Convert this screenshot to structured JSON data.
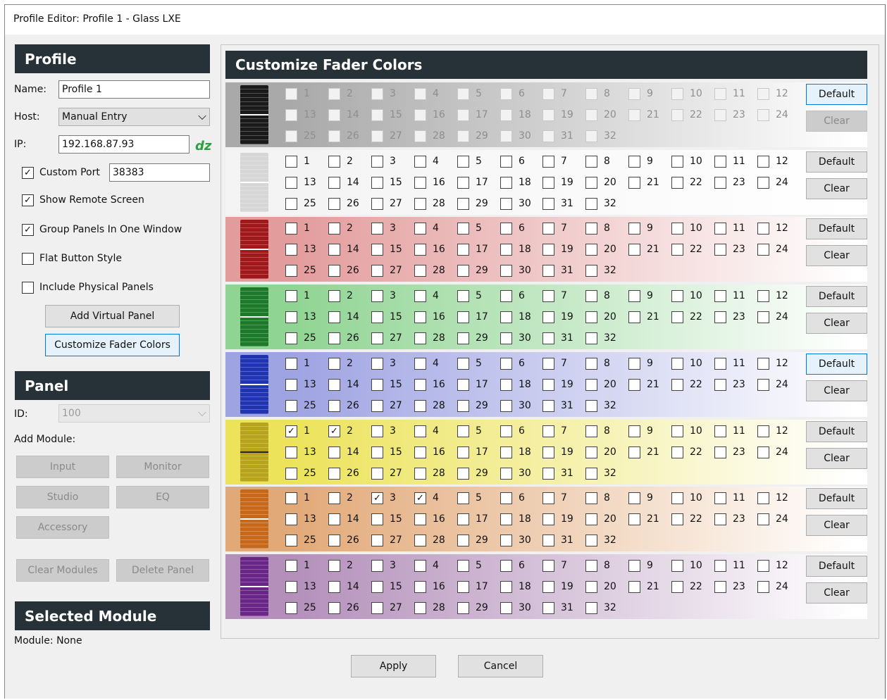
{
  "window": {
    "title": "Profile Editor: Profile 1 - Glass LXE"
  },
  "profile": {
    "header": "Profile",
    "name_label": "Name:",
    "name_value": "Profile 1",
    "host_label": "Host:",
    "host_value": "Manual Entry",
    "ip_label": "IP:",
    "ip_value": "192.168.87.93",
    "custom_port_label": "Custom Port",
    "custom_port_checked": true,
    "custom_port_value": "38383",
    "show_remote_label": "Show Remote Screen",
    "show_remote_checked": true,
    "group_panels_label": "Group Panels In One Window",
    "group_panels_checked": true,
    "flat_button_label": "Flat Button Style",
    "flat_button_checked": false,
    "include_physical_label": "Include Physical Panels",
    "include_physical_checked": false,
    "add_virtual_panel": "Add Virtual Panel",
    "customize_fader_colors": "Customize Fader Colors"
  },
  "panel": {
    "header": "Panel",
    "id_label": "ID:",
    "id_value": "100",
    "add_module_label": "Add Module:",
    "buttons": {
      "input": "Input",
      "monitor": "Monitor",
      "studio": "Studio",
      "eq": "EQ",
      "accessory": "Accessory",
      "clear_modules": "Clear Modules",
      "delete_panel": "Delete Panel"
    }
  },
  "selected_module": {
    "header": "Selected Module",
    "module_text": "Module: None"
  },
  "fader_colors": {
    "header": "Customize Fader Colors",
    "default_label": "Default",
    "clear_label": "Clear",
    "channels": [
      "1",
      "2",
      "3",
      "4",
      "5",
      "6",
      "7",
      "8",
      "9",
      "10",
      "11",
      "12",
      "13",
      "14",
      "15",
      "16",
      "17",
      "18",
      "19",
      "20",
      "21",
      "22",
      "23",
      "24",
      "25",
      "26",
      "27",
      "28",
      "29",
      "30",
      "31",
      "32"
    ],
    "rows": [
      {
        "color": "black",
        "bg": "#a9a9a9",
        "fader": "#1a1a1a",
        "line": "#ffffff",
        "disabled": true,
        "checked": []
      },
      {
        "color": "white",
        "bg": "#f4f4f4",
        "fader": "#d6d6d6",
        "line": "#ffffff",
        "disabled": false,
        "checked": []
      },
      {
        "color": "red",
        "bg": "#e39c9c",
        "fader": "#a0191a",
        "line": "#ffffff",
        "disabled": false,
        "checked": []
      },
      {
        "color": "green",
        "bg": "#8fd492",
        "fader": "#1e7a2b",
        "line": "#ffffff",
        "disabled": false,
        "checked": []
      },
      {
        "color": "blue",
        "bg": "#9ea3e2",
        "fader": "#2235b0",
        "line": "#ffffff",
        "disabled": false,
        "checked": []
      },
      {
        "color": "yellow",
        "bg": "#ece35a",
        "fader": "#b8a41c",
        "line": "#222222",
        "disabled": false,
        "checked": [
          "1",
          "2"
        ]
      },
      {
        "color": "orange",
        "bg": "#e2a978",
        "fader": "#c86818",
        "line": "#ffffff",
        "disabled": false,
        "checked": [
          "3",
          "4"
        ]
      },
      {
        "color": "purple",
        "bg": "#b38fba",
        "fader": "#6a2588",
        "line": "#ffffff",
        "disabled": false,
        "checked": []
      }
    ]
  },
  "footer": {
    "apply": "Apply",
    "cancel": "Cancel"
  },
  "icons": {
    "check": "✓",
    "dz_logo": "dz"
  }
}
